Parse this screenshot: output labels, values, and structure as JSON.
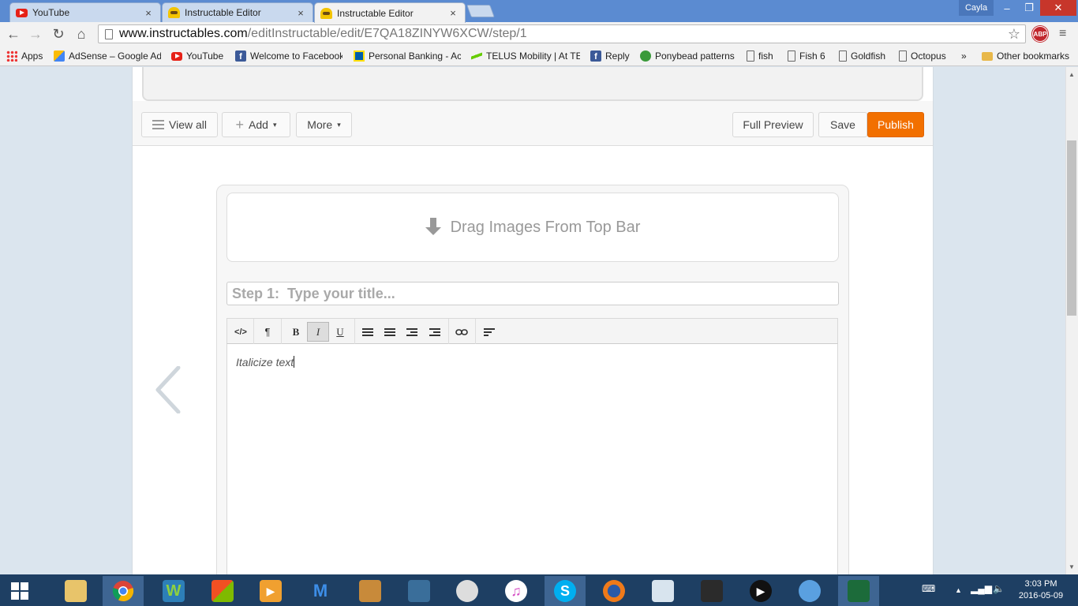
{
  "browser": {
    "tabs": [
      {
        "title": "YouTube",
        "icon": "youtube-icon",
        "active": false
      },
      {
        "title": "Instructable Editor",
        "icon": "instructables-icon",
        "active": false
      },
      {
        "title": "Instructable Editor",
        "icon": "instructables-icon",
        "active": true
      }
    ],
    "tab_close": "×",
    "user_name": "Cayla",
    "window_controls": {
      "minimize": "–",
      "maximize": "❐",
      "close": "✕"
    },
    "nav": {
      "back": "←",
      "forward": "→",
      "reload": "↻",
      "home": "⌂"
    },
    "url_host": "www.instructables.com",
    "url_path": "/editInstructable/edit/E7QA18ZINYW6XCW/step/1",
    "star": "☆",
    "abp_label": "ABP",
    "menu": "≡"
  },
  "bookmarks": {
    "items": [
      {
        "label": "Apps",
        "icon": "apps-icon"
      },
      {
        "label": "AdSense – Google Ad",
        "icon": "adsense-icon"
      },
      {
        "label": "YouTube",
        "icon": "youtube-icon"
      },
      {
        "label": "Welcome to Facebook",
        "icon": "facebook-icon"
      },
      {
        "label": "Personal Banking - Ac",
        "icon": "rbc-icon"
      },
      {
        "label": "TELUS Mobility | At TE",
        "icon": "telus-icon"
      },
      {
        "label": "Reply",
        "icon": "facebook-icon"
      },
      {
        "label": "Ponybead patterns",
        "icon": "ponybead-icon"
      },
      {
        "label": "fish",
        "icon": "page-icon"
      },
      {
        "label": "Fish 6",
        "icon": "page-icon"
      },
      {
        "label": "Goldfish",
        "icon": "page-icon"
      },
      {
        "label": "Octopus",
        "icon": "page-icon"
      }
    ],
    "overflow": "»",
    "other": "Other bookmarks"
  },
  "editor": {
    "view_all": "View all",
    "add": "Add",
    "more": "More",
    "full_preview": "Full Preview",
    "save": "Save",
    "publish": "Publish",
    "caret": "▾"
  },
  "step": {
    "drop_text": "Drag Images From Top Bar",
    "title_placeholder": "Step 1:  Type your title...",
    "body_text": "Italicize text"
  },
  "rte": {
    "code": "</>",
    "paragraph": "¶",
    "bold": "B",
    "italic": "I",
    "underline": "U"
  },
  "taskbar": {
    "time": "3:03 PM",
    "date": "2016-05-09"
  },
  "colors": {
    "publish": "#f27000",
    "chrome_frame": "#5b8bd1",
    "taskbar": "#1e3f63"
  }
}
